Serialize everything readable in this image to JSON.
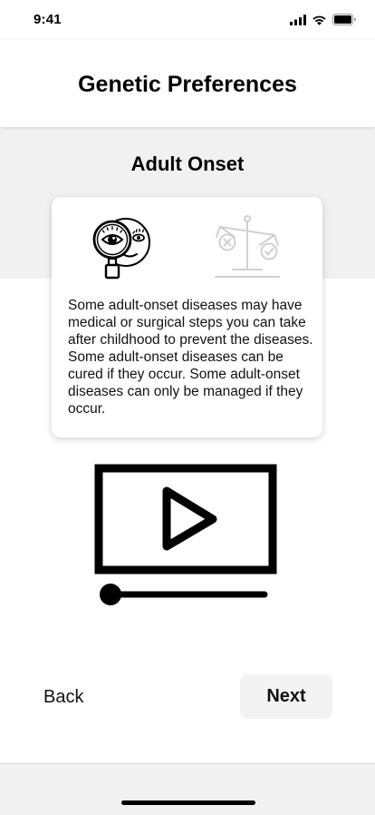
{
  "status_bar": {
    "time": "9:41",
    "icons": [
      "cellular-signal-icon",
      "wifi-icon",
      "battery-icon"
    ]
  },
  "header": {
    "title": "Genetic Preferences"
  },
  "section": {
    "title": "Adult Onset"
  },
  "card": {
    "icons": [
      "magnifying-glass-inspect-icon",
      "balance-scale-icon"
    ],
    "text": "Some adult-onset diseases may have medical or surgical steps you can take after childhood to prevent the diseases. Some adult-onset diseases can be cured if they occur. Some adult-onset diseases can only be managed if they occur."
  },
  "video": {
    "icon": "video-play-icon",
    "progress": 0.0
  },
  "nav": {
    "back_label": "Back",
    "next_label": "Next"
  },
  "colors": {
    "background": "#ffffff",
    "band": "#f1f1f1",
    "next_button_bg": "#f3f3f3",
    "inactive_icon": "#d0d0d0"
  }
}
